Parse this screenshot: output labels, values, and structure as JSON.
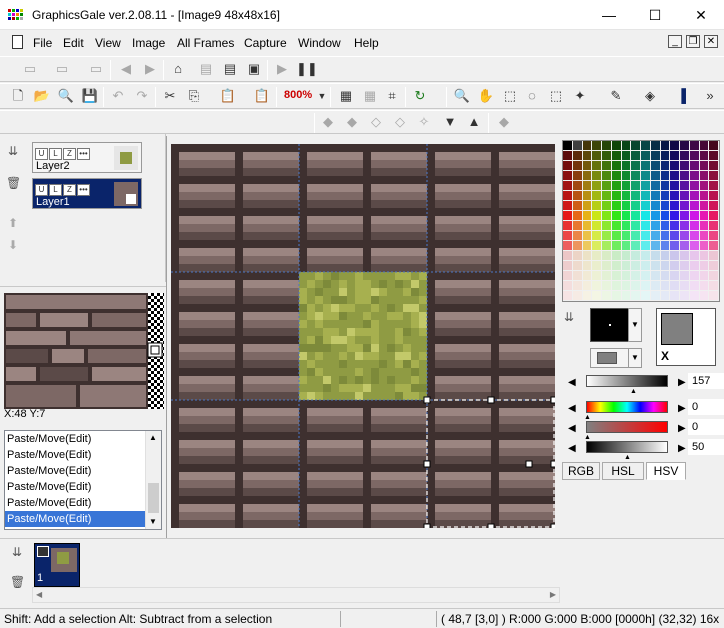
{
  "window": {
    "title": "GraphicsGale ver.2.08.11 - [Image9 48x48x16]",
    "minimize_glyph": "—",
    "maximize_glyph": "☐",
    "close_glyph": "✕"
  },
  "menu": {
    "items": [
      "File",
      "Edit",
      "View",
      "Image",
      "All Frames",
      "Capture",
      "Window",
      "Help"
    ],
    "mdi_minimize": "_",
    "mdi_restore": "❐",
    "mdi_close": "✕"
  },
  "toolbar": {
    "zoom": "800%"
  },
  "layers": [
    {
      "name": "Layer2",
      "selected": false
    },
    {
      "name": "Layer1",
      "selected": true
    }
  ],
  "layer_flags": [
    "U",
    "L",
    "Z",
    "•••"
  ],
  "cursor_position": "X:48 Y:7",
  "history": [
    "Paste/Move(Edit)",
    "Paste/Move(Edit)",
    "Paste/Move(Edit)",
    "Paste/Move(Edit)",
    "Paste/Move(Edit)",
    "Paste/Move(Edit)"
  ],
  "history_selected_index": 5,
  "palette": {
    "current_bg_label": "X",
    "sliders": [
      {
        "name": "luminance",
        "value": "157"
      },
      {
        "name": "hue",
        "value": "0"
      },
      {
        "name": "saturation",
        "value": "0"
      },
      {
        "name": "lightness",
        "value": "50"
      }
    ],
    "tabs": [
      "RGB",
      "HSL",
      "HSV"
    ],
    "active_tab": "HSL"
  },
  "frames": [
    {
      "label": "1"
    }
  ],
  "status": {
    "hint": "Shift: Add a selection  Alt: Subtract from a selection",
    "info": "( 48,7 [3,0] ) R:000 G:000 B:000  [0000h]  (32,32) 16x"
  },
  "colors": {
    "brick_light": "#9b8581",
    "brick_mid": "#7d6865",
    "brick_dark": "#5b4a48",
    "mortar": "#3e302f",
    "grass_light": "#a7b04f",
    "grass_mid": "#8f9b43",
    "selection_blue": "#0a246a",
    "history_highlight": "#3875d7"
  }
}
